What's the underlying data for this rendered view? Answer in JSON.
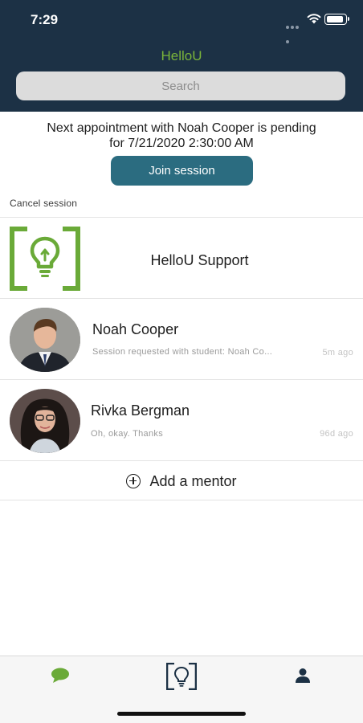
{
  "status_bar": {
    "time": "7:29"
  },
  "header": {
    "title": "HelloU",
    "search_placeholder": "Search"
  },
  "appointment": {
    "line1": "Next appointment with Noah Cooper is pending",
    "line2": "for 7/21/2020 2:30:00 AM",
    "join_label": "Join session",
    "cancel_label": "Cancel session"
  },
  "conversations": [
    {
      "name": "HelloU Support",
      "icon": "lightbulb-icon"
    },
    {
      "name": "Noah Cooper",
      "preview": "Session requested with student: Noah Co...",
      "time": "5m ago"
    },
    {
      "name": "Rivka Bergman",
      "preview": "Oh, okay. Thanks",
      "time": "96d ago"
    }
  ],
  "add_mentor": {
    "label": "Add a mentor",
    "icon": "plus-circle-icon"
  },
  "tabbar": {
    "tabs": [
      {
        "name": "chat",
        "icon": "chat-bubble-icon",
        "color": "#6aaa38"
      },
      {
        "name": "home",
        "icon": "lightbulb-logo-icon",
        "color": "#1c3145"
      },
      {
        "name": "profile",
        "icon": "person-icon",
        "color": "#1c3145"
      }
    ]
  },
  "colors": {
    "header_bg": "#1c3145",
    "brand_green": "#6aaa38",
    "button_teal": "#2b6c80"
  }
}
